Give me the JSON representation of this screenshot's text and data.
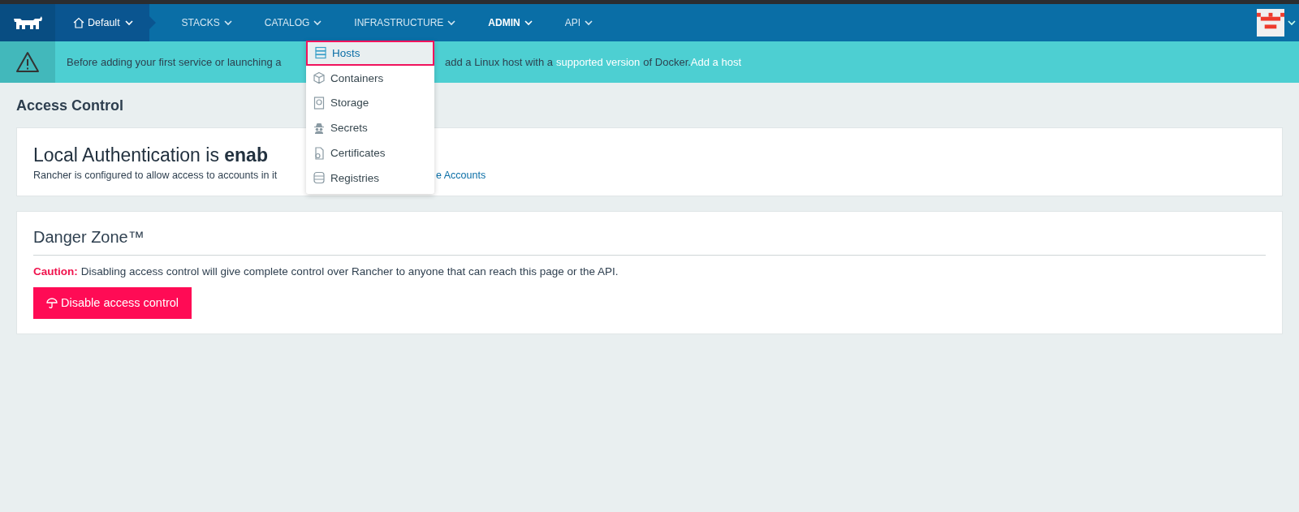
{
  "env": {
    "label": "Default"
  },
  "nav": [
    {
      "label": "STACKS",
      "selected": false
    },
    {
      "label": "CATALOG",
      "selected": false
    },
    {
      "label": "INFRASTRUCTURE",
      "selected": false
    },
    {
      "label": "ADMIN",
      "selected": true
    },
    {
      "label": "API",
      "selected": false
    }
  ],
  "banner": {
    "before": "Before adding your first service or launching a",
    "after": "add a Linux host with a",
    "link": "supported version",
    "after_link": "of Docker.",
    "action": "Add a host"
  },
  "dropdown": [
    {
      "label": "Hosts",
      "selected": true
    },
    {
      "label": "Containers",
      "selected": false
    },
    {
      "label": "Storage",
      "selected": false
    },
    {
      "label": "Secrets",
      "selected": false
    },
    {
      "label": "Certificates",
      "selected": false
    },
    {
      "label": "Registries",
      "selected": false
    }
  ],
  "page_title": "Access Control",
  "auth_card": {
    "heading": "Local Authentication is **enab**",
    "text": "Rancher is configured to allow access to accounts in it",
    "link": "e Accounts"
  },
  "danger_card": {
    "heading": "Danger Zone™",
    "caution_label": "Caution:",
    "caution_text": "Disabling access control will give complete control over Rancher to anyone that can reach this page or the API.",
    "button": "Disable access control"
  }
}
